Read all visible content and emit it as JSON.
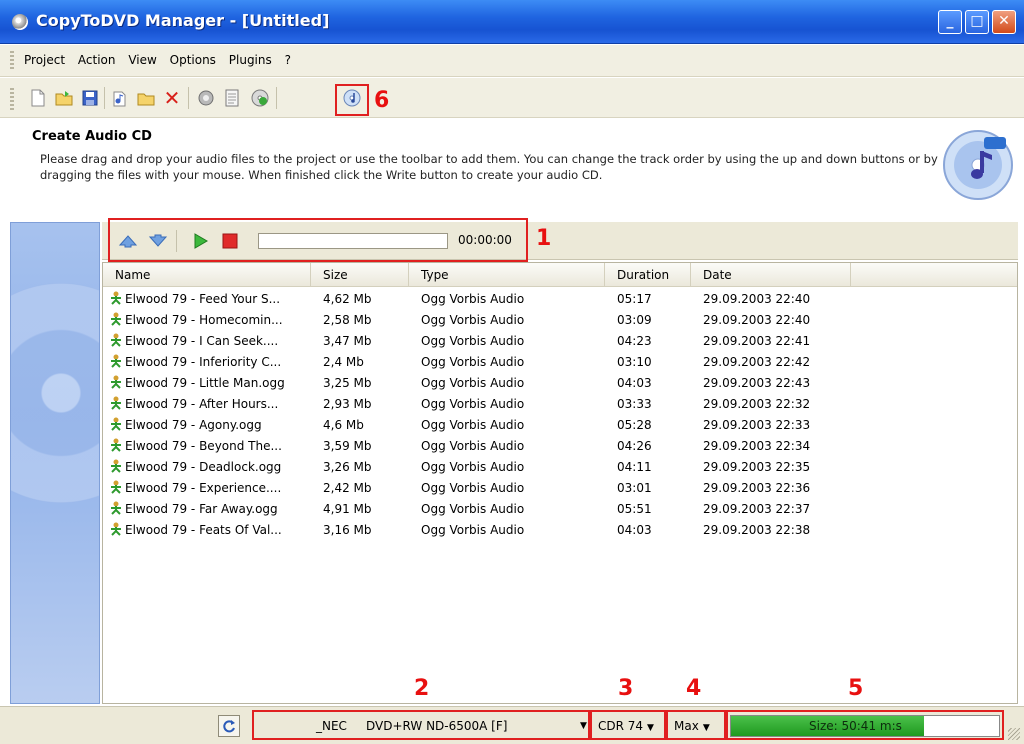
{
  "window": {
    "title": "CopyToDVD Manager - [Untitled]",
    "minimize": "_",
    "maximize": "□",
    "close": "✕"
  },
  "menu": [
    "Project",
    "Action",
    "View",
    "Options",
    "Plugins",
    "?"
  ],
  "toolbar": {
    "icons": [
      "new-project-icon",
      "open-icon",
      "save-icon",
      "add-files-icon",
      "add-folder-icon",
      "delete-icon",
      "settings-icon",
      "properties-icon",
      "disc-info-icon",
      "write-audio-cd-icon"
    ]
  },
  "annotations": {
    "n1": "1",
    "n2": "2",
    "n3": "3",
    "n4": "4",
    "n5": "5",
    "n6": "6",
    "color": "#e02020"
  },
  "header": {
    "title": "Create Audio CD",
    "description": "Please drag and drop your audio files to the project or use the toolbar to add them. You can change the track order by using the up and down buttons or by dragging the files with your mouse. When finished click the Write button to create your audio CD."
  },
  "player": {
    "time": "00:00:00",
    "progress": 0
  },
  "columns": [
    "Name",
    "Size",
    "Type",
    "Duration",
    "Date"
  ],
  "rows": [
    [
      "Elwood 79 - Feed Your S...",
      "4,62 Mb",
      "Ogg Vorbis Audio",
      "05:17",
      "29.09.2003 22:40"
    ],
    [
      "Elwood 79 - Homecomin...",
      "2,58 Mb",
      "Ogg Vorbis Audio",
      "03:09",
      "29.09.2003 22:40"
    ],
    [
      "Elwood 79 - I Can Seek....",
      "3,47 Mb",
      "Ogg Vorbis Audio",
      "04:23",
      "29.09.2003 22:41"
    ],
    [
      "Elwood 79 - Inferiority C...",
      "2,4 Mb",
      "Ogg Vorbis Audio",
      "03:10",
      "29.09.2003 22:42"
    ],
    [
      "Elwood 79 - Little Man.ogg",
      "3,25 Mb",
      "Ogg Vorbis Audio",
      "04:03",
      "29.09.2003 22:43"
    ],
    [
      "Elwood 79 - After Hours...",
      "2,93 Mb",
      "Ogg Vorbis Audio",
      "03:33",
      "29.09.2003 22:32"
    ],
    [
      "Elwood 79 - Agony.ogg",
      "4,6 Mb",
      "Ogg Vorbis Audio",
      "05:28",
      "29.09.2003 22:33"
    ],
    [
      "Elwood 79 - Beyond The...",
      "3,59 Mb",
      "Ogg Vorbis Audio",
      "04:26",
      "29.09.2003 22:34"
    ],
    [
      "Elwood 79 - Deadlock.ogg",
      "3,26 Mb",
      "Ogg Vorbis Audio",
      "04:11",
      "29.09.2003 22:35"
    ],
    [
      "Elwood 79 - Experience....",
      "2,42 Mb",
      "Ogg Vorbis Audio",
      "03:01",
      "29.09.2003 22:36"
    ],
    [
      "Elwood 79 - Far Away.ogg",
      "4,91 Mb",
      "Ogg Vorbis Audio",
      "05:51",
      "29.09.2003 22:37"
    ],
    [
      "Elwood 79 - Feats Of Val...",
      "3,16 Mb",
      "Ogg Vorbis Audio",
      "04:03",
      "29.09.2003 22:38"
    ]
  ],
  "status": {
    "drive": "_NEC     DVD+RW ND-6500A [F]",
    "media": "CDR 74",
    "speed": "Max",
    "size": "Size: 50:41 m:s",
    "size_fill": 0.72,
    "size_color": "#2aa82a"
  }
}
